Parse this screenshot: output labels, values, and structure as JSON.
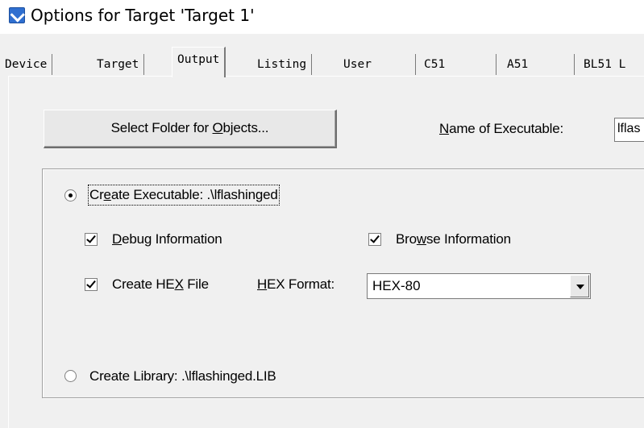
{
  "window": {
    "title": "Options for Target 'Target 1'"
  },
  "tabs": [
    {
      "label": "Device"
    },
    {
      "label": "Target"
    },
    {
      "label": "Output"
    },
    {
      "label": "Listing"
    },
    {
      "label": "User"
    },
    {
      "label": "C51"
    },
    {
      "label": "A51"
    },
    {
      "label": "BL51 L"
    }
  ],
  "active_tab": "Output",
  "output": {
    "select_folder_button": {
      "pre": "Select Folder for ",
      "key": "O",
      "post": "bjects..."
    },
    "name_of_executable": {
      "key": "N",
      "post": "ame of Executable:",
      "value": "lflas"
    },
    "create_executable": {
      "pre": "Cr",
      "key": "e",
      "post": "ate Executable:  .\\lflashinged",
      "selected": true
    },
    "debug_information": {
      "key": "D",
      "post": "ebug Information",
      "checked": true
    },
    "browse_information": {
      "pre": "Bro",
      "key": "w",
      "post": "se Information",
      "checked": true
    },
    "create_hex_file": {
      "pre": "Create HE",
      "key": "X",
      "post": " File",
      "checked": true
    },
    "hex_format": {
      "key": "H",
      "post": "EX Format:",
      "value": "HEX-80"
    },
    "create_library": {
      "label": "Create Library:  .\\lflashinged.LIB",
      "selected": false
    }
  }
}
